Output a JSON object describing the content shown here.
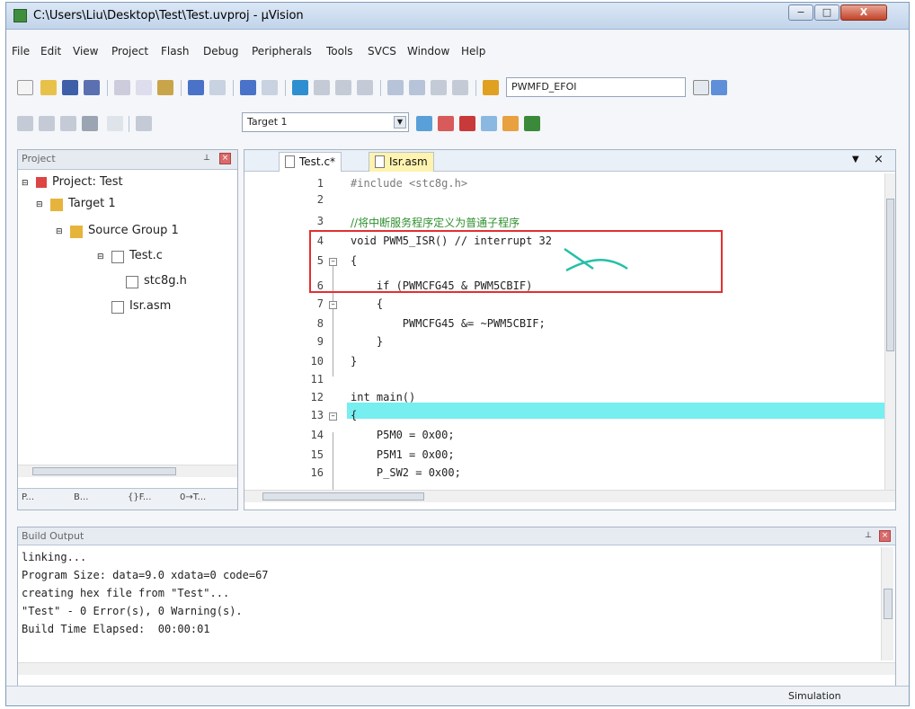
{
  "window": {
    "title": "C:\\Users\\Liu\\Desktop\\Test\\Test.uvproj - µVision",
    "buttons": {
      "min": "−",
      "max": "□",
      "close": "X"
    }
  },
  "menubar": [
    "File",
    "Edit",
    "View",
    "Project",
    "Flash",
    "Debug",
    "Peripherals",
    "Tools",
    "SVCS",
    "Window",
    "Help"
  ],
  "toolbar": {
    "search_value": "PWMFD_EFOI",
    "target_value": "Target 1"
  },
  "project": {
    "title": "Project",
    "tree": [
      "Project: Test",
      "Target 1",
      "Source Group 1",
      "Test.c",
      "stc8g.h",
      "Isr.asm"
    ],
    "tabs": [
      "P...",
      "B...",
      "{}F...",
      "0→T..."
    ]
  },
  "editor": {
    "tabs": [
      "Test.c*",
      "Isr.asm"
    ],
    "line_numbers": [
      "1",
      "2",
      "3",
      "4",
      "5",
      "6",
      "7",
      "8",
      "9",
      "10",
      "11",
      "12",
      "13",
      "14",
      "15",
      "16"
    ],
    "lines": [
      "#include <stc8g.h>",
      "",
      "//将中断服务程序定义为普通子程序",
      "void PWM5_ISR() // interrupt 32",
      "{",
      "    if (PWMCFG45 & PWM5CBIF)",
      "    {",
      "        PWMCFG45 &= ~PWM5CBIF;",
      "    }",
      "}",
      "",
      "int main()",
      "{",
      "    P5M0 = 0x00;",
      "    P5M1 = 0x00;",
      "    P_SW2 = 0x00;"
    ],
    "highlight_color": "#77eef0",
    "annotation_color": "#e03030"
  },
  "build": {
    "title": "Build Output",
    "lines": [
      "linking...",
      "Program Size: data=9.0 xdata=0 code=67",
      "creating hex file from \"Test\"...",
      "\"Test\" - 0 Error(s), 0 Warning(s).",
      "Build Time Elapsed:  00:00:01"
    ]
  },
  "status": {
    "mode": "Simulation"
  }
}
